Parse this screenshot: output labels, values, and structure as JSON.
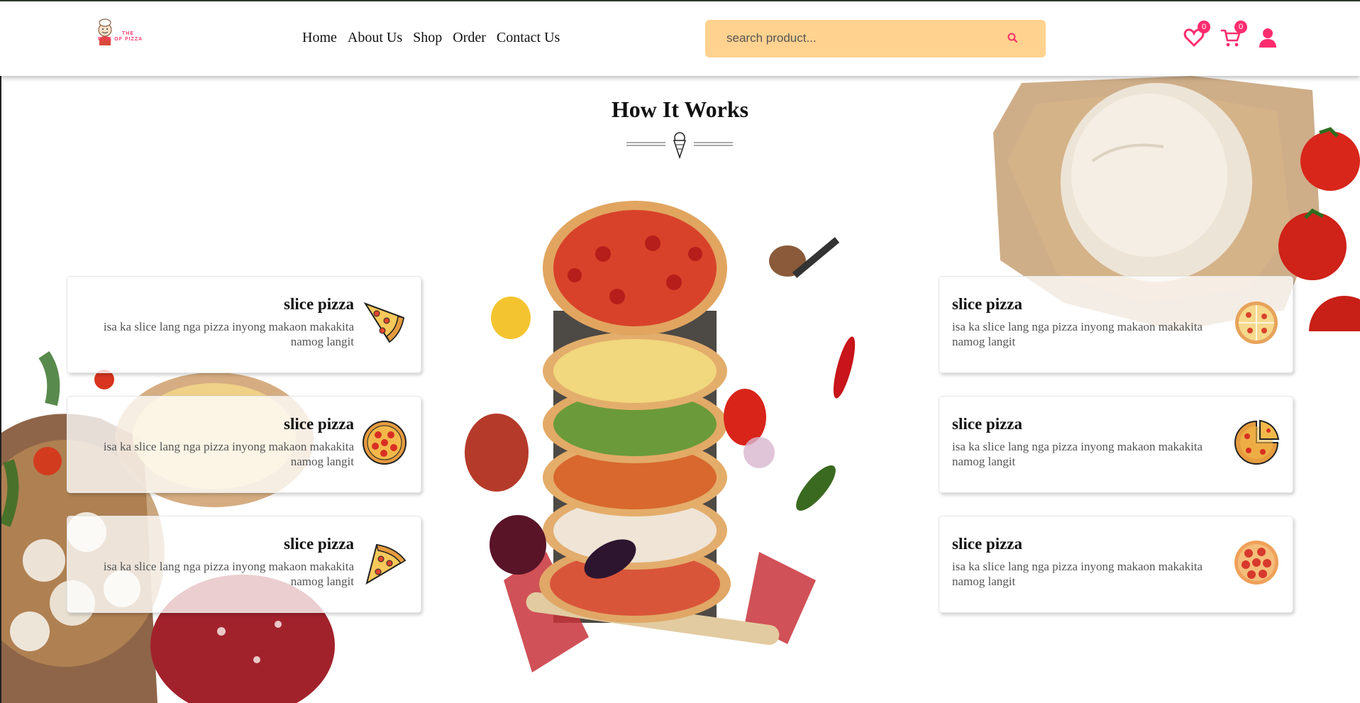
{
  "logo": {
    "text_line1": "THE",
    "text_line2": "RISE OF PIZZA"
  },
  "nav": {
    "items": [
      "Home",
      "About Us",
      "Shop",
      "Order",
      "Contact Us"
    ]
  },
  "search": {
    "placeholder": "search product..."
  },
  "header_icons": {
    "wishlist_count": "0",
    "cart_count": "0"
  },
  "section": {
    "title": "How It Works"
  },
  "cards_left": [
    {
      "title": "slice pizza",
      "text": "isa ka slice lang nga pizza inyong makaon makakita namog langit",
      "icon": "pizza-slice-icon"
    },
    {
      "title": "slice pizza",
      "text": "isa ka slice lang nga pizza inyong makaon makakita namog langit",
      "icon": "whole-pizza-icon"
    },
    {
      "title": "slice pizza",
      "text": "isa ka slice lang nga pizza inyong makaon makakita namog langit",
      "icon": "pizza-slice-icon"
    }
  ],
  "cards_right": [
    {
      "title": "slice pizza",
      "text": "isa ka slice lang nga pizza inyong makaon makakita namog langit",
      "icon": "whole-pizza-icon"
    },
    {
      "title": "slice pizza",
      "text": "isa ka slice lang nga pizza inyong makaon makakita namog langit",
      "icon": "pizza-missing-slice-icon"
    },
    {
      "title": "slice pizza",
      "text": "isa ka slice lang nga pizza inyong makaon makakita namog langit",
      "icon": "pepperoni-pizza-icon"
    }
  ],
  "colors": {
    "accent": "#ff2d6f",
    "search_bg": "#ffd28f"
  }
}
